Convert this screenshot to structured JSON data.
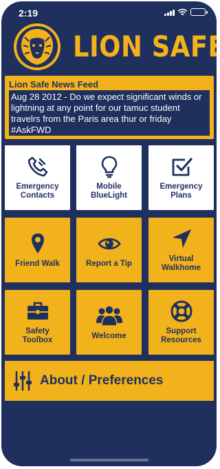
{
  "status_bar": {
    "time": "2:19"
  },
  "header": {
    "title": "LION SAFE"
  },
  "news_feed": {
    "title": "Lion Safe News Feed",
    "body": "Aug 28 2012 - Do we expect significant winds or lightning at any point for our tamuc student travelrs from the Paris area thur or friday #AskFWD"
  },
  "tiles": [
    {
      "label": "Emergency\nContacts",
      "icon": "phone-icon",
      "style": "white"
    },
    {
      "label": "Mobile\nBlueLight",
      "icon": "lightbulb-icon",
      "style": "white"
    },
    {
      "label": "Emergency\nPlans",
      "icon": "checkbox-icon",
      "style": "white"
    },
    {
      "label": "Friend Walk",
      "icon": "map-pin-icon",
      "style": "gold"
    },
    {
      "label": "Report a Tip",
      "icon": "eye-icon",
      "style": "gold"
    },
    {
      "label": "Virtual\nWalkhome",
      "icon": "navigation-arrow-icon",
      "style": "gold"
    },
    {
      "label": "Safety\nToolbox",
      "icon": "toolbox-icon",
      "style": "gold"
    },
    {
      "label": "Welcome",
      "icon": "group-icon",
      "style": "gold"
    },
    {
      "label": "Support\nResources",
      "icon": "lifebuoy-icon",
      "style": "gold"
    }
  ],
  "about": {
    "label": "About / Preferences",
    "icon": "sliders-icon"
  },
  "colors": {
    "navy": "#1f2f5e",
    "gold": "#f2b21c",
    "white": "#ffffff"
  }
}
